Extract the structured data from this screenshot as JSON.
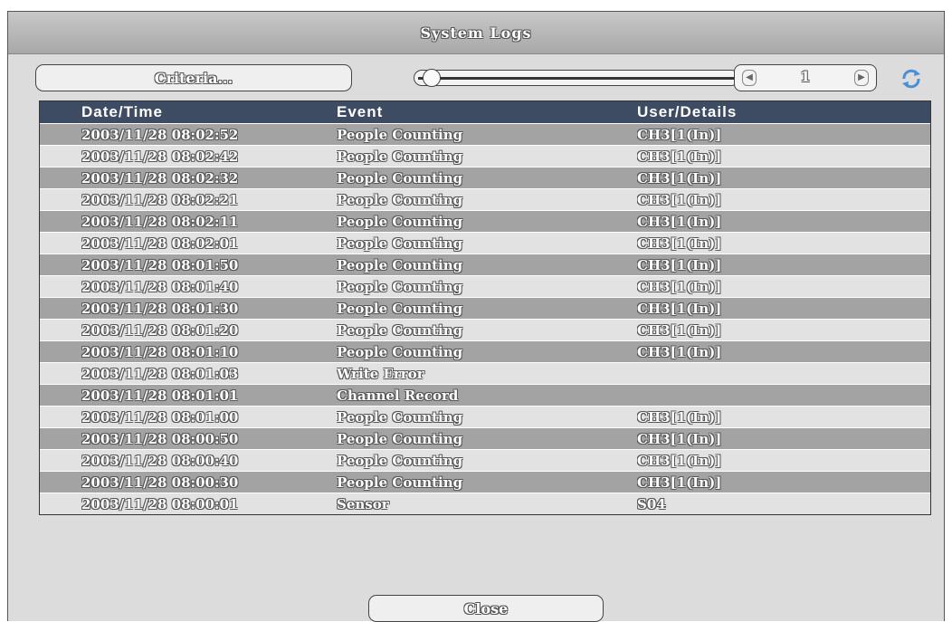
{
  "window": {
    "title": "System Logs"
  },
  "toolbar": {
    "criteria_label": "Criteria...",
    "page_value": "1",
    "slider_position": 0.02,
    "prev_icon": "chevron-left-icon",
    "next_icon": "chevron-right-icon",
    "refresh_icon": "refresh-icon"
  },
  "table": {
    "columns": [
      "Date/Time",
      "Event",
      "User/Details"
    ],
    "rows": [
      [
        "2003/11/28 08:02:52",
        "People Counting",
        "CH3[1(In)]"
      ],
      [
        "2003/11/28 08:02:42",
        "People Counting",
        "CH3[1(In)]"
      ],
      [
        "2003/11/28 08:02:32",
        "People Counting",
        "CH3[1(In)]"
      ],
      [
        "2003/11/28 08:02:21",
        "People Counting",
        "CH3[1(In)]"
      ],
      [
        "2003/11/28 08:02:11",
        "People Counting",
        "CH3[1(In)]"
      ],
      [
        "2003/11/28 08:02:01",
        "People Counting",
        "CH3[1(In)]"
      ],
      [
        "2003/11/28 08:01:50",
        "People Counting",
        "CH3[1(In)]"
      ],
      [
        "2003/11/28 08:01:40",
        "People Counting",
        "CH3[1(In)]"
      ],
      [
        "2003/11/28 08:01:30",
        "People Counting",
        "CH3[1(In)]"
      ],
      [
        "2003/11/28 08:01:20",
        "People Counting",
        "CH3[1(In)]"
      ],
      [
        "2003/11/28 08:01:10",
        "People Counting",
        "CH3[1(In)]"
      ],
      [
        "2003/11/28 08:01:03",
        "Write Error",
        ""
      ],
      [
        "2003/11/28 08:01:01",
        "Channel Record",
        ""
      ],
      [
        "2003/11/28 08:01:00",
        "People Counting",
        "CH3[1(In)]"
      ],
      [
        "2003/11/28 08:00:50",
        "People Counting",
        "CH3[1(In)]"
      ],
      [
        "2003/11/28 08:00:40",
        "People Counting",
        "CH3[1(In)]"
      ],
      [
        "2003/11/28 08:00:30",
        "People Counting",
        "CH3[1(In)]"
      ],
      [
        "2003/11/28 08:00:01",
        "Sensor",
        "S04"
      ]
    ]
  },
  "footer": {
    "close_label": "Close"
  },
  "colors": {
    "header_bg": "#3e4c63",
    "row_dark": "#a3a3a3",
    "row_light": "#e2e2e2",
    "panel_bg": "#dcdcdc"
  }
}
